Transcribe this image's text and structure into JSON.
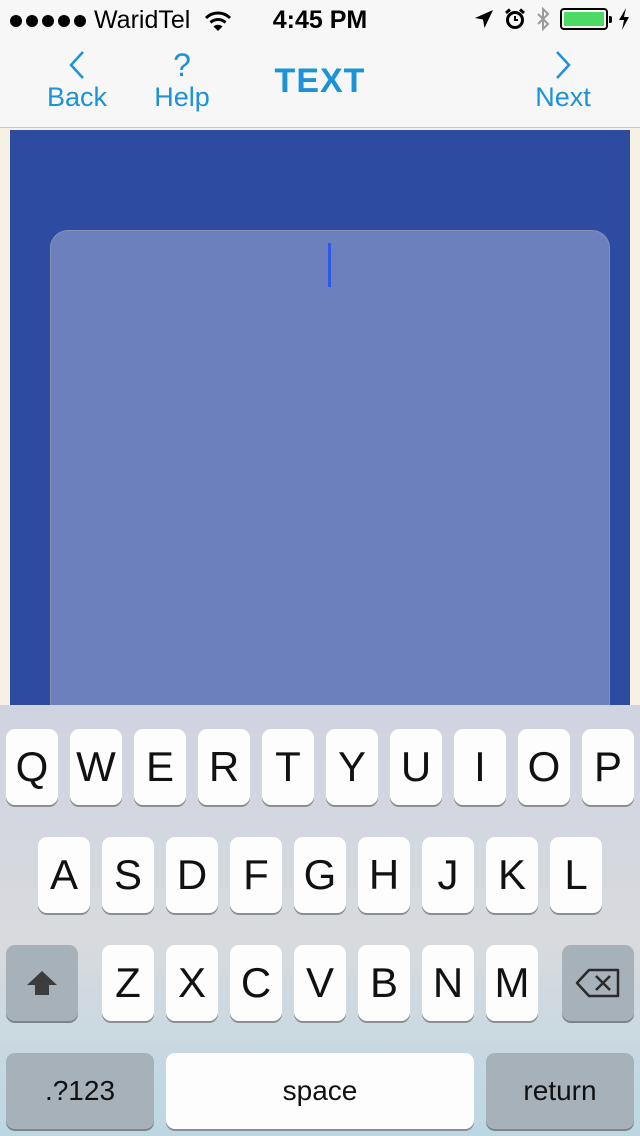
{
  "status_bar": {
    "carrier": "WaridTel",
    "time": "4:45 PM",
    "battery_color": "#4cd964",
    "icons": [
      "signal-icon",
      "wifi-icon",
      "location-icon",
      "alarm-icon",
      "bluetooth-icon",
      "battery-icon",
      "charging-icon"
    ]
  },
  "nav": {
    "back_label": "Back",
    "help_label": "Help",
    "help_glyph": "?",
    "title": "TEXT",
    "next_label": "Next",
    "accent_color": "#1c93d8"
  },
  "content": {
    "background_color": "#2d4ba1",
    "text_area_value": ""
  },
  "keyboard": {
    "row1": [
      "Q",
      "W",
      "E",
      "R",
      "T",
      "Y",
      "U",
      "I",
      "O",
      "P"
    ],
    "row2": [
      "A",
      "S",
      "D",
      "F",
      "G",
      "H",
      "J",
      "K",
      "L"
    ],
    "row3": [
      "Z",
      "X",
      "C",
      "V",
      "B",
      "N",
      "M"
    ],
    "numbers_label": ".?123",
    "space_label": "space",
    "return_label": "return"
  }
}
